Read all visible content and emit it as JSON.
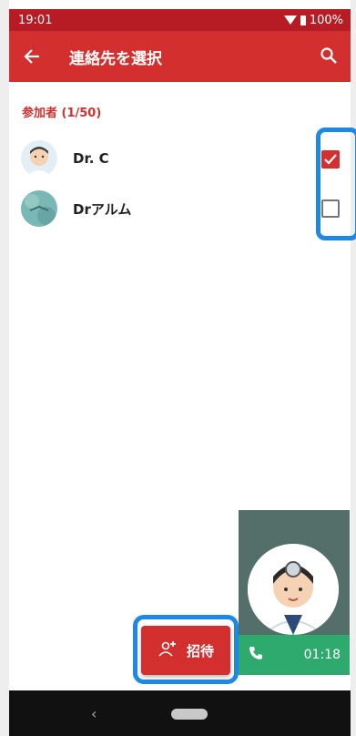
{
  "status_bar": {
    "time": "19:01",
    "battery": "100%"
  },
  "app_bar": {
    "title": "連絡先を選択"
  },
  "section": {
    "label": "参加者 (1/50)"
  },
  "contacts": [
    {
      "name": "Dr. C",
      "checked": true
    },
    {
      "name": "Drアルム",
      "checked": false
    }
  ],
  "call": {
    "elapsed": "01:18"
  },
  "invite_button": {
    "label": "招待"
  },
  "colors": {
    "primary": "#d32f2f",
    "status_bar": "#b71c25",
    "call_green": "#2eaa6e",
    "highlight": "#1e88e5"
  },
  "icons": [
    "back-arrow-icon",
    "search-icon",
    "add-person-icon",
    "phone-icon",
    "wifi-icon",
    "battery-icon"
  ]
}
